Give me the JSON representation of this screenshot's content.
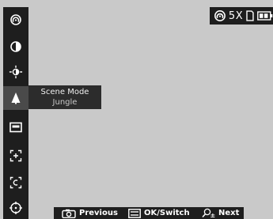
{
  "popup": {
    "title": "Scene Mode",
    "value": "Jungle"
  },
  "status": {
    "zoom": "5X"
  },
  "bottom_bar": {
    "previous": "Previous",
    "ok_switch": "OK/Switch",
    "next": "Next"
  },
  "sidebar": {
    "items": [
      {
        "icon": "hotspot-tracking-icon"
      },
      {
        "icon": "contrast-icon"
      },
      {
        "icon": "brightness-icon"
      },
      {
        "icon": "scene-mode-icon",
        "active": true
      },
      {
        "icon": "display-mode-icon"
      },
      {
        "icon": "focus-frame-icon"
      },
      {
        "icon": "capture-icon"
      },
      {
        "icon": "crosshair-icon"
      }
    ]
  },
  "colors": {
    "view_background": "#c9c9c9",
    "bar_background": "#1e1e1e",
    "active_item": "#4a4a4a"
  }
}
